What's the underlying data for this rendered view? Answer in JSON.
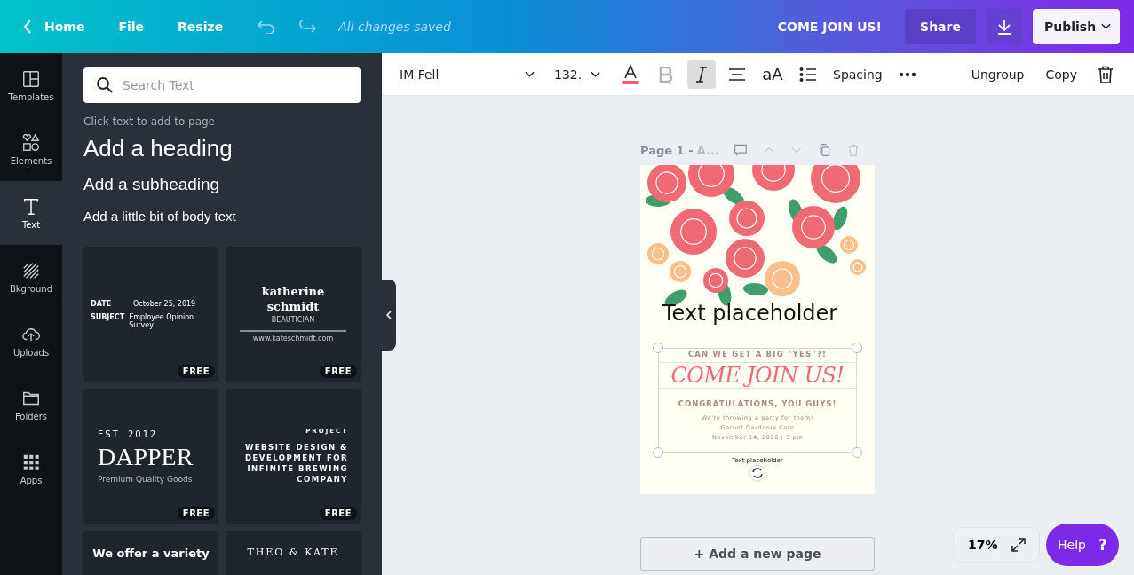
{
  "top_bar": {
    "back": "Home",
    "menu": [
      "File",
      "Resize"
    ],
    "status": "All changes saved",
    "design_title": "COME JOIN US!",
    "share": "Share",
    "publish": "Publish"
  },
  "sidebar": {
    "items": [
      {
        "label": "Templates",
        "kind": "templates",
        "selected": false
      },
      {
        "label": "Elements",
        "kind": "elements",
        "selected": false
      },
      {
        "label": "Text",
        "kind": "text",
        "selected": true
      },
      {
        "label": "Bkground",
        "kind": "background",
        "selected": false
      },
      {
        "label": "Uploads",
        "kind": "uploads",
        "selected": false
      },
      {
        "label": "Folders",
        "kind": "folders",
        "selected": false
      },
      {
        "label": "Apps",
        "kind": "apps",
        "selected": false
      }
    ]
  },
  "text_panel": {
    "search": {
      "placeholder": "Search Text"
    },
    "hint": "Click text to add to page",
    "presets": [
      {
        "kind": "heading",
        "label": "Add a heading"
      },
      {
        "kind": "subheading",
        "label": "Add a subheading"
      },
      {
        "kind": "body",
        "label": "Add a little bit of body text"
      }
    ],
    "templates": [
      {
        "kind": "memo",
        "rows": [
          [
            "DATE",
            "October 25, 2019"
          ],
          [
            "SUBJECT",
            "Employee Opinion Survey"
          ]
        ],
        "badge": "FREE"
      },
      {
        "kind": "card",
        "lines": [
          "katherine",
          "schmidt",
          "BEAUTICIAN",
          "www.kateschmidt.com"
        ],
        "badge": "FREE"
      },
      {
        "kind": "logo",
        "lines": [
          "EST. 2012",
          "DAPPER",
          "Premium Quality Goods"
        ],
        "badge": "FREE"
      },
      {
        "kind": "project",
        "lines": [
          "PROJECT",
          "WEBSITE DESIGN & DEVELOPMENT FOR INFINITE BREWING COMPANY"
        ],
        "badge": "FREE"
      },
      {
        "kind": "promo",
        "lines": [
          "We offer a variety"
        ]
      },
      {
        "kind": "names",
        "lines": [
          "THEO & KATE"
        ]
      }
    ]
  },
  "toolbar": {
    "font": "IM Fell",
    "size": "132.",
    "tools": [
      {
        "kind": "color",
        "disabled": false,
        "selected": false
      },
      {
        "kind": "bold",
        "disabled": true,
        "selected": false
      },
      {
        "kind": "italic",
        "disabled": false,
        "selected": true
      },
      {
        "kind": "align",
        "disabled": false,
        "selected": false
      },
      {
        "kind": "case",
        "label": "aA",
        "disabled": false,
        "selected": false
      },
      {
        "kind": "list",
        "disabled": false,
        "selected": false
      },
      {
        "kind": "spacing",
        "label": "Spacing",
        "disabled": false,
        "selected": false
      },
      {
        "kind": "more",
        "disabled": false,
        "selected": false
      }
    ],
    "actions": [
      "Ungroup",
      "Copy"
    ]
  },
  "page": {
    "label": "Page 1 -",
    "name": "A...",
    "overlay_text": "Text placeholder",
    "texts": [
      {
        "kind": "kicker",
        "text": "CAN WE GET A BIG \"YES\"?!"
      },
      {
        "kind": "title",
        "text": "COME JOIN US!"
      },
      {
        "kind": "subtitle",
        "text": "CONGRATULATIONS, YOU GUYS!"
      },
      {
        "kind": "detail",
        "text": "We're throwing a party for them!"
      },
      {
        "kind": "detail",
        "text": "Garnet Gardenia Cafe"
      },
      {
        "kind": "detail",
        "text": "November 14, 2020 | 3 pm"
      }
    ],
    "small_text": "Text placeholder"
  },
  "add_page": "+ Add a new page",
  "zoom": "17%",
  "help": "Help",
  "help_icon": "?"
}
